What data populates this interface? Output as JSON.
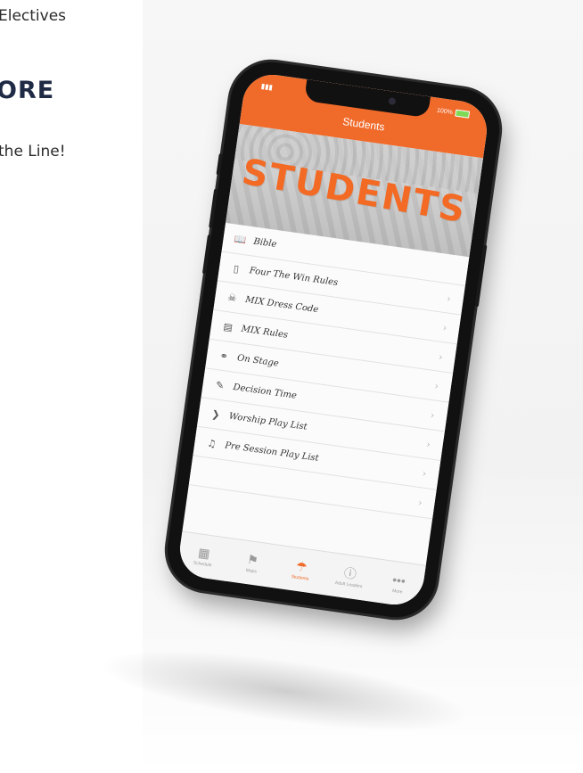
{
  "page": {
    "electives_text": "Electives",
    "heading": "ORE",
    "line_text": "the Line!"
  },
  "phone": {
    "status": {
      "time": "9:41 AM",
      "battery": "100%"
    },
    "nav_title": "Students",
    "banner_text": "STUDENTS",
    "menu_items": [
      {
        "label": "Bible",
        "icon": "book-icon"
      },
      {
        "label": "Four The Win Rules",
        "icon": "document-icon"
      },
      {
        "label": "MIX Dress Code",
        "icon": "shirt-icon"
      },
      {
        "label": "MIX Rules",
        "icon": "list-icon"
      },
      {
        "label": "On Stage",
        "icon": "microphone-icon"
      },
      {
        "label": "Decision Time",
        "icon": "scroll-icon"
      },
      {
        "label": "Worship Play List",
        "icon": "rss-icon"
      },
      {
        "label": "Pre Session Play List",
        "icon": "music-icon"
      }
    ],
    "tabs": [
      {
        "label": "Schedule",
        "icon": "calendar-icon"
      },
      {
        "label": "Maps",
        "icon": "map-icon"
      },
      {
        "label": "Students",
        "icon": "shirt-icon",
        "active": true
      },
      {
        "label": "Adult Leaders",
        "icon": "info-icon"
      },
      {
        "label": "More",
        "icon": "more-icon"
      }
    ]
  },
  "colors": {
    "accent": "#f06a2a",
    "heading": "#1f2a44"
  }
}
